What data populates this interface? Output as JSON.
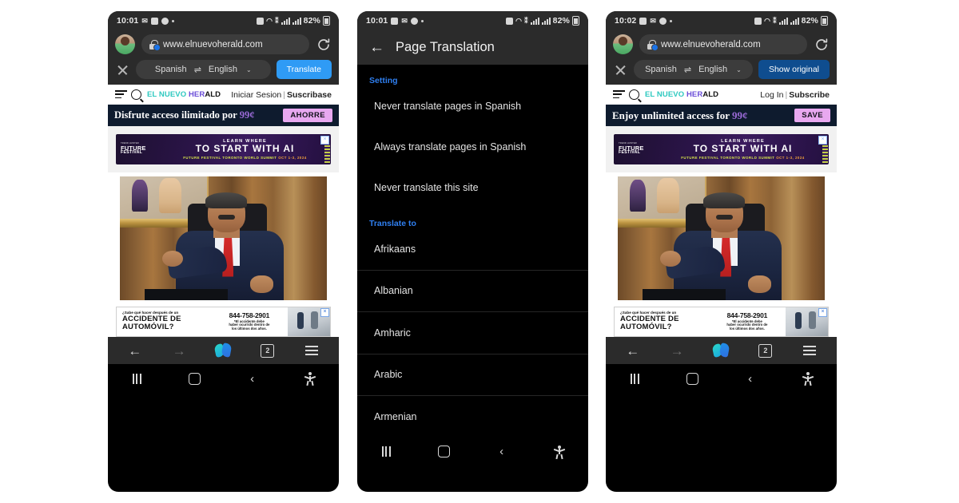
{
  "status_bars": {
    "phone1_time": "10:01",
    "phone2_time": "10:01",
    "phone3_time": "10:02",
    "battery": "82%",
    "icons": [
      "messaging-icon",
      "gallery-icon",
      "app-badge-icon",
      "dot-icon",
      "alarm-icon",
      "headphones-icon",
      "vibrate-icon",
      "signal-icon",
      "signal-icon",
      "battery-icon"
    ]
  },
  "browser": {
    "url": "www.elnuevoherald.com",
    "lock_label": "secure-site",
    "reload_label": "reload"
  },
  "translate_bar": {
    "close_label": "×",
    "source_lang": "Spanish",
    "swap_symbol": "⇌",
    "target_lang": "English",
    "caret": "⌄",
    "button_translate": "Translate",
    "button_show_original": "Show original",
    "accent_blue": "#2f9bf5",
    "accent_dark_blue": "#0f4d8f"
  },
  "news_page_es": {
    "masthead_1": "EL NUEVO",
    "masthead_2": "HER",
    "masthead_3": "ALD",
    "nav_login": "Iniciar Sesion",
    "nav_sep": "|",
    "nav_subscribe": "Suscribase",
    "promo_text": "Disfrute acceso ilimitado por",
    "promo_price": "99¢",
    "promo_button": "AHORRE"
  },
  "news_page_en": {
    "masthead_1": "EL NUEVO",
    "masthead_2": "HER",
    "masthead_3": "ALD",
    "nav_login": "Log In",
    "nav_sep": "|",
    "nav_subscribe": "Subscribe",
    "promo_text": "Enjoy unlimited access for",
    "promo_price": "99¢",
    "promo_button": "SAVE"
  },
  "ad_top": {
    "brand_pre": "TREND HUNTER",
    "brand_line1": "FUTURE",
    "brand_line2": "FESTIVAL",
    "line1": "LEARN WHERE",
    "line2": "TO START WITH AI",
    "line3": "FUTURE FESTIVAL TORONTO WORLD SUMMIT",
    "line3_date": "OCT 1-3, 2024",
    "close_label": "×"
  },
  "ad_bottom": {
    "small_line": "¿Sabe qué hacer después de un",
    "headline_1": "ACCIDENTE DE",
    "headline_2": "AUTOMÓVIL?",
    "phone": "844-758-2901",
    "fine_1": "*El accidente debe",
    "fine_2": "haber ocurrido dentro de",
    "fine_3": "los últimos dos años.",
    "close_label": "×"
  },
  "article_photo": {
    "alt": "Man in dark suit and red tie pointing while seated at a desk in a wood-paneled room"
  },
  "browser_bottom": {
    "back": "←",
    "forward": "→",
    "copilot_label": "copilot",
    "tab_count": "2",
    "menu_label": "menu"
  },
  "android_nav": {
    "recents_label": "recents",
    "home_label": "home",
    "back_label": "back",
    "accessibility_label": "accessibility"
  },
  "translation_panel": {
    "back_arrow": "←",
    "title": "Page Translation",
    "section_setting": "Setting",
    "settings": [
      "Never translate pages in Spanish",
      "Always translate pages in Spanish",
      "Never translate this site"
    ],
    "section_translate_to": "Translate to",
    "languages": [
      "Afrikaans",
      "Albanian",
      "Amharic",
      "Arabic",
      "Armenian"
    ],
    "section_color": "#2f7ff0"
  }
}
